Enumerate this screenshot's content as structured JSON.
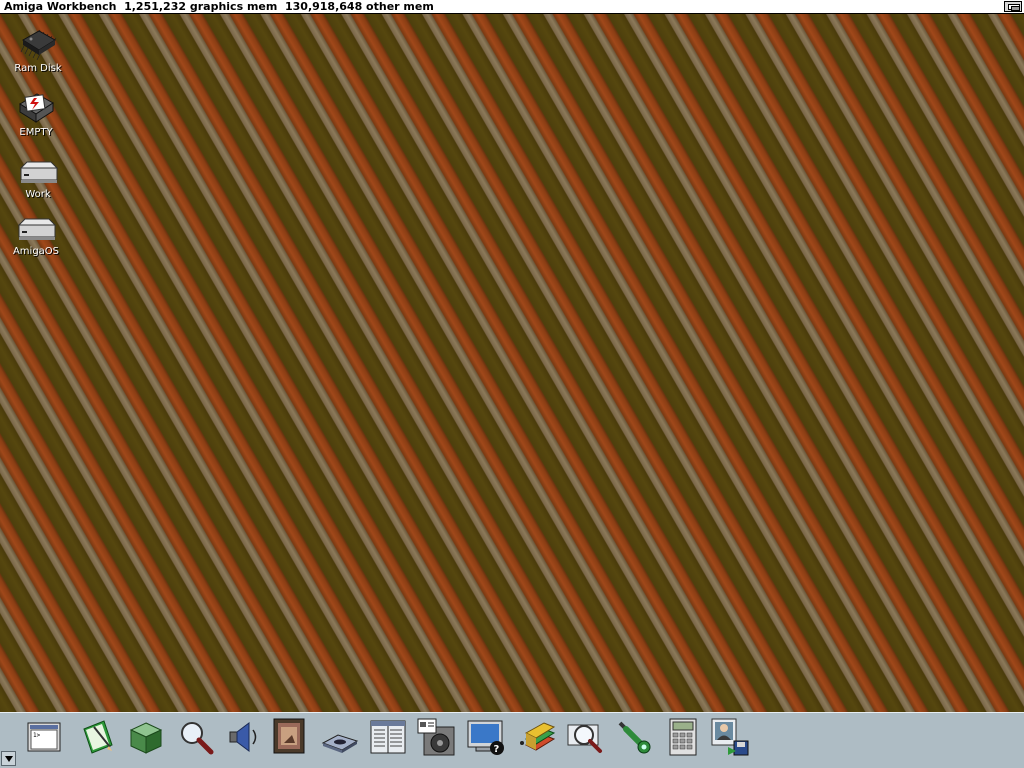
{
  "screen": {
    "title": "Amiga Workbench  1,251,232 graphics mem  130,918,648 other mem"
  },
  "desktop_icons": [
    {
      "label": "Ram Disk",
      "icon": "ram-disk-icon"
    },
    {
      "label": "EMPTY",
      "icon": "empty-drive-icon"
    },
    {
      "label": "Work",
      "icon": "hard-drive-icon"
    },
    {
      "label": "AmigaOS",
      "icon": "hard-drive-icon"
    }
  ],
  "dock": {
    "items": [
      {
        "icon": "shell-icon"
      },
      {
        "icon": "notepad-icon"
      },
      {
        "icon": "cube-icon"
      },
      {
        "icon": "magnifier-icon"
      },
      {
        "icon": "speaker-icon"
      },
      {
        "icon": "picture-frame-icon"
      },
      {
        "icon": "disk-drive-icon"
      },
      {
        "icon": "spreadsheet-icon"
      },
      {
        "icon": "media-player-icon"
      },
      {
        "icon": "monitor-help-icon"
      },
      {
        "icon": "books-icon"
      },
      {
        "icon": "zoom-search-icon"
      },
      {
        "icon": "wrench-icon"
      },
      {
        "icon": "calculator-icon"
      },
      {
        "icon": "contact-save-icon"
      }
    ]
  },
  "colors": {
    "wallpaper_dark": "#4d3f0d",
    "wallpaper_stripe_light": "#8c7a5a",
    "wallpaper_stripe_orange": "#a0481a",
    "dock_background": "#aebcc4",
    "titlebar": "#ffffff"
  }
}
